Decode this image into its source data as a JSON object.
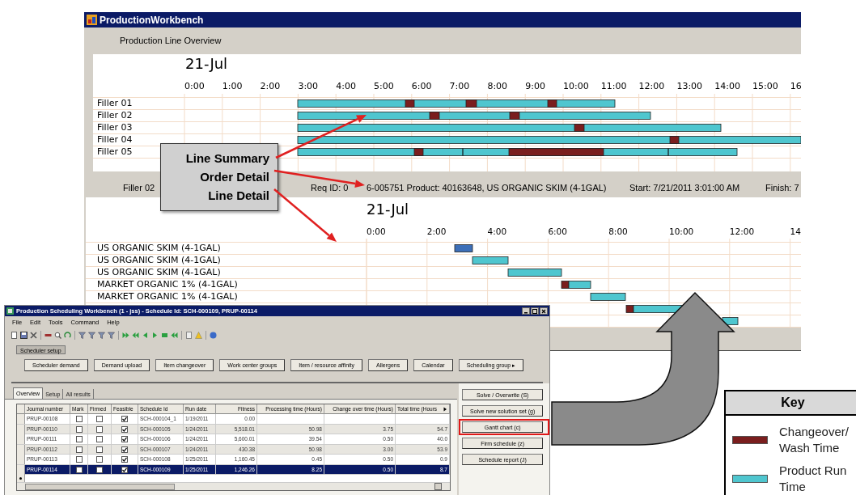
{
  "overview_window": {
    "title": "ProductionWorkbench",
    "section_label": "Production Line Overview",
    "date": "21-Jul",
    "hours": [
      "0:00",
      "1:00",
      "2:00",
      "3:00",
      "4:00",
      "5:00",
      "6:00",
      "7:00",
      "8:00",
      "9:00",
      "10:00",
      "11:00",
      "12:00",
      "13:00",
      "14:00",
      "15:00",
      "16"
    ],
    "lines": [
      "Filler 01",
      "Filler 02",
      "Filler 03",
      "Filler 04",
      "Filler 05"
    ]
  },
  "order_detail_bar": {
    "line": "Filler 02",
    "req_id_start": "Req ID: 0",
    "req_id_rest": "6-005751 Product: 40163648, US ORGANIC SKIM (4-1GAL)",
    "start": "Start: 7/21/2011 3:01:00 AM",
    "finish": "Finish: 7"
  },
  "line_detail": {
    "date": "21-Jul",
    "hours": [
      "0:00",
      "2:00",
      "4:00",
      "6:00",
      "8:00",
      "10:00",
      "12:00",
      "14"
    ],
    "orders": [
      "US ORGANIC SKIM (4-1GAL)",
      "US ORGANIC SKIM (4-1GAL)",
      "US ORGANIC SKIM (4-1GAL)",
      "MARKET ORGANIC 1% (4-1GAL)",
      "MARKET ORGANIC 1% (4-1GAL)"
    ]
  },
  "callout": {
    "labels": [
      "Line Summary",
      "Order Detail",
      "Line Detail"
    ]
  },
  "scheduling_window": {
    "title": "Production Scheduling Workbench (1 - jss) - Schedule Id: SCH-000109, PRUP-00114",
    "menu": [
      "File",
      "Edit",
      "Tools",
      "Command",
      "Help"
    ],
    "group_label": "Scheduler setup",
    "setup_buttons": [
      "Scheduler demand",
      "Demand upload",
      "Item changeover",
      "Work center groups",
      "Item / resource affinity",
      "Allergens",
      "Calendar",
      "Scheduling group ▸"
    ],
    "tabs": [
      {
        "label": "Overview",
        "selected": true
      },
      {
        "label": "Setup",
        "selected": false
      },
      {
        "label": "All results",
        "selected": false
      }
    ],
    "table": {
      "columns": [
        "Journal number",
        "Mark",
        "Firmed",
        "Feasible",
        "Schedule Id",
        "Run date",
        "Fitness",
        "Processing time (Hours)",
        "Change over time (Hours)",
        "Total time (Hours"
      ],
      "rows": [
        {
          "journal": "PRUP-00108",
          "mark": false,
          "firmed": false,
          "feasible": true,
          "schedule_id": "SCH-000104_1",
          "run_date": "1/19/2011",
          "fitness": "0.00",
          "selected": false
        },
        {
          "journal": "PRUP-00110",
          "mark": false,
          "firmed": false,
          "feasible": true,
          "schedule_id": "SCH-000105",
          "run_date": "1/24/2011",
          "fitness": "5,518.01",
          "processing": "50.98",
          "changeover": "3.75",
          "total": "54.7",
          "selected": false
        },
        {
          "journal": "PRUP-00111",
          "mark": false,
          "firmed": false,
          "feasible": true,
          "schedule_id": "SCH-000106",
          "run_date": "1/24/2011",
          "fitness": "5,600.01",
          "processing": "39.54",
          "changeover": "0.50",
          "total": "40.0",
          "selected": false
        },
        {
          "journal": "PRUP-00112",
          "mark": false,
          "firmed": false,
          "feasible": true,
          "schedule_id": "SCH-000107",
          "run_date": "1/24/2011",
          "fitness": "430.38",
          "processing": "50.98",
          "changeover": "3.00",
          "total": "53.9",
          "selected": false
        },
        {
          "journal": "PRUP-00113",
          "mark": false,
          "firmed": false,
          "feasible": true,
          "schedule_id": "SCH-000108",
          "run_date": "1/25/2011",
          "fitness": "1,160.45",
          "processing": "0.45",
          "changeover": "0.50",
          "total": "0.9",
          "selected": false
        },
        {
          "journal": "PRUP-00114",
          "mark": false,
          "firmed": false,
          "feasible": true,
          "schedule_id": "SCH-000109",
          "run_date": "1/25/2011",
          "fitness": "1,246.26",
          "processing": "8.25",
          "changeover": "0.50",
          "total": "8.7",
          "selected": true
        }
      ]
    },
    "side_buttons": [
      {
        "label": "Solve / Overwrite (S)",
        "highlighted": false
      },
      {
        "label": "Solve new solution set (g)",
        "highlighted": false
      },
      {
        "label": "Gantt chart (c)",
        "highlighted": true
      },
      {
        "label": "Firm schedule (z)",
        "highlighted": false
      },
      {
        "label": "Schedule report (J)",
        "highlighted": false
      }
    ]
  },
  "key": {
    "title": "Key",
    "items": [
      {
        "kind": "changeover",
        "label": "Changeover/ Wash Time",
        "color": "#7a1e1e"
      },
      {
        "kind": "run",
        "label": "Product Run Time",
        "color": "#4fc6cf"
      }
    ]
  }
}
